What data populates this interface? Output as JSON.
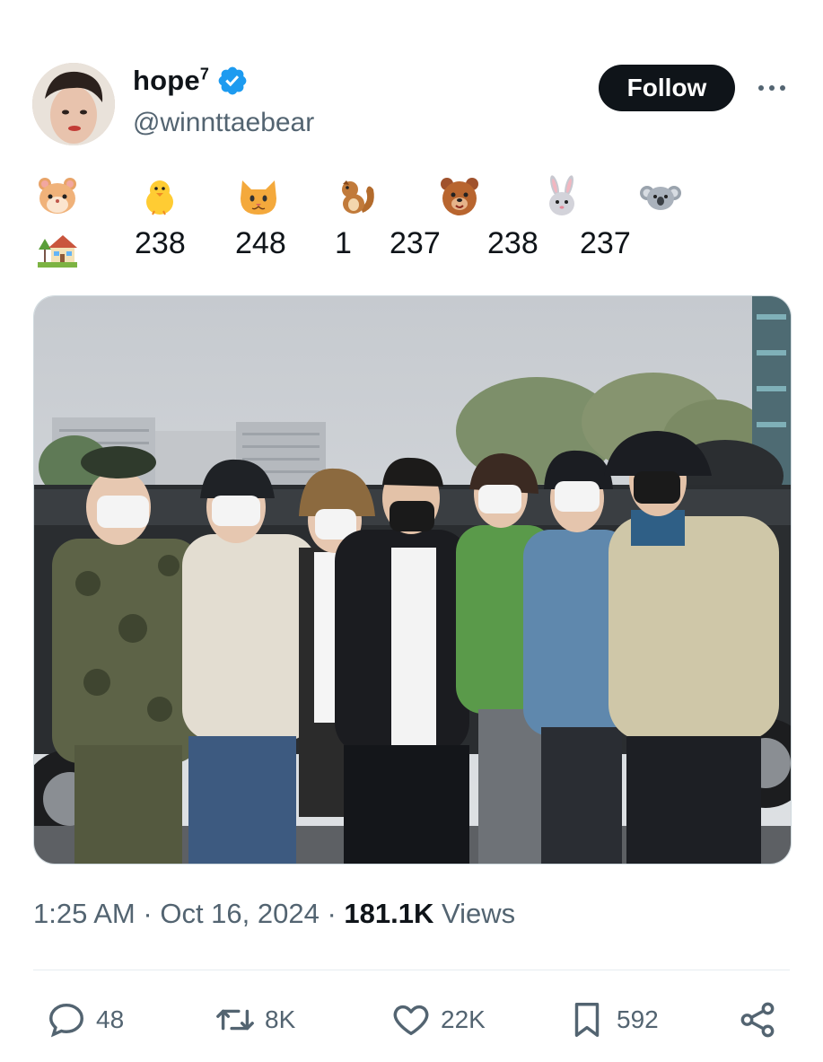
{
  "author": {
    "display_name": "hope",
    "name_superscript": "7",
    "handle": "@winnttaebear",
    "verified": true
  },
  "follow_label": "Follow",
  "emoji_stats": {
    "emojis": [
      "hamster-icon",
      "chick-icon",
      "cat-icon",
      "chipmunk-icon",
      "bear-icon",
      "rabbit-icon",
      "koala-icon"
    ],
    "row_icon": "house-icon",
    "counts": [
      "238",
      "248",
      "1",
      "237",
      "238",
      "237"
    ]
  },
  "meta": {
    "time": "1:25 AM",
    "sep1": "·",
    "date": "Oct 16, 2024",
    "sep2": "·",
    "views_count": "181.1K",
    "views_label": "Views"
  },
  "actions": {
    "replies": "48",
    "reposts": "8K",
    "likes": "22K",
    "bookmarks": "592"
  },
  "colors": {
    "accent": "#1d9bf0",
    "text": "#0f1419",
    "muted": "#536471"
  }
}
